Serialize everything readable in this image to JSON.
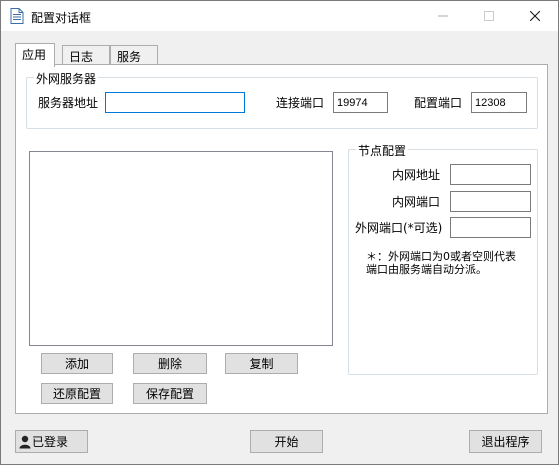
{
  "window": {
    "title": "配置对话框",
    "minimize_glyph": "—",
    "maximize_glyph": "☐",
    "close_glyph": "✕"
  },
  "tabs": [
    {
      "label": "应用",
      "active": true
    },
    {
      "label": "日志",
      "active": false
    },
    {
      "label": "服务",
      "active": false
    }
  ],
  "external_server": {
    "group_title": "外网服务器",
    "address_label": "服务器地址",
    "address_value": "",
    "connect_port_label": "连接端口",
    "connect_port_value": "19974",
    "config_port_label": "配置端口",
    "config_port_value": "12308"
  },
  "node_config": {
    "group_title": "节点配置",
    "inner_address_label": "内网地址",
    "inner_address_value": "",
    "inner_port_label": "内网端口",
    "inner_port_value": "",
    "external_port_label": "外网端口(*可选)",
    "external_port_value": "",
    "hint": "＊：外网端口为0或者空则代表端口由服务端自动分派。"
  },
  "list_buttons": {
    "add": "添加",
    "delete": "删除",
    "copy": "复制",
    "restore": "还原配置",
    "save": "保存配置"
  },
  "footer": {
    "login_status": "已登录",
    "start": "开始",
    "exit": "退出程序"
  }
}
